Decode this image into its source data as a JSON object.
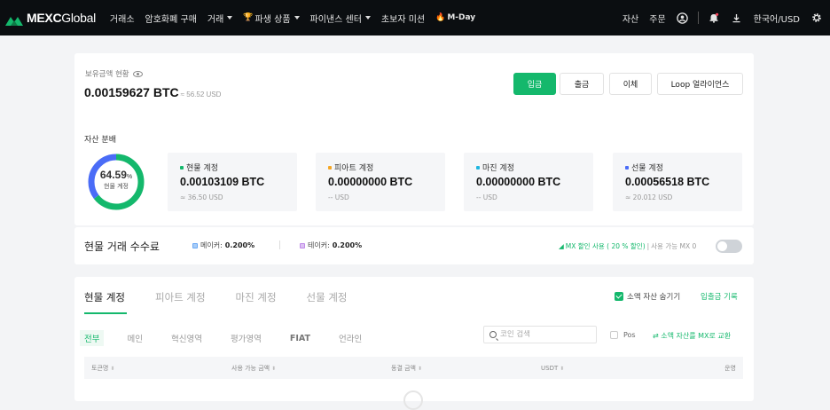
{
  "header": {
    "logo_text_1": "MEXC",
    "logo_text_2": "Global",
    "nav": [
      {
        "label": "거래소",
        "caret": false
      },
      {
        "label": "암호화폐 구매",
        "caret": false
      },
      {
        "label": "거래",
        "caret": true
      },
      {
        "label": "파생 상품",
        "caret": true,
        "icon": "trophy-icon"
      },
      {
        "label": "파이낸스 센터",
        "caret": true
      },
      {
        "label": "초보자 미션",
        "caret": false
      },
      {
        "label": "M-Day",
        "caret": false,
        "icon": "flame-icon"
      }
    ],
    "right": {
      "assets": "자산",
      "orders": "주문",
      "language": "한국어/USD"
    }
  },
  "balance": {
    "label": "보유금액 현황",
    "btc": "0.00159627 BTC",
    "usd": "≈ 56.52 USD",
    "buttons": {
      "deposit": "입금",
      "withdraw": "출금",
      "transfer": "이체",
      "loop": "Loop 얼라이언스"
    }
  },
  "distribution": {
    "label": "자산 분배",
    "percent": "64.59",
    "percent_unit": "%",
    "center_label": "현물 계정",
    "accounts": [
      {
        "name": "현물 계정",
        "btc": "0.00103109 BTC",
        "usd": "≈ 36.50 USD",
        "color": "#14b86c"
      },
      {
        "name": "피아트 계정",
        "btc": "0.00000000 BTC",
        "usd": "-- USD",
        "color": "#f5a623"
      },
      {
        "name": "마진 계정",
        "btc": "0.00000000 BTC",
        "usd": "-- USD",
        "color": "#1fb6e0"
      },
      {
        "name": "선물 계정",
        "btc": "0.00056518 BTC",
        "usd": "≈ 20.012 USD",
        "color": "#4a6cf7"
      }
    ]
  },
  "fee": {
    "title": "현물 거래 수수료",
    "maker_label": "메이커:",
    "maker_value": "0.200%",
    "taker_label": "테이커:",
    "taker_value": "0.200%",
    "mx_discount": "MX 할인 사용 ( 20 % 할인)",
    "mx_available": "사용 가능 MX 0"
  },
  "accounts_tabs": {
    "tabs": [
      "현물 계정",
      "피아트 계정",
      "마진 계정",
      "선물 계정"
    ],
    "hide_small": "소액 자산 숨기기",
    "deposit_history": "입출금 기록",
    "subtabs": [
      "전부",
      "메인",
      "혁신영역",
      "평가영역",
      "FIAT",
      "언라인"
    ],
    "search_placeholder": "코인 검색",
    "pos": "Pos",
    "convert_small": "소액 자산를 MX로 교환",
    "columns": [
      "토큰명",
      "사용 가능 금액",
      "동결 금액",
      "USDT",
      "운영"
    ]
  },
  "colors": {
    "accent": "#14b86c",
    "header_bg": "#0b0e11",
    "maker": "#6aa8f5",
    "taker": "#c08ae8"
  }
}
